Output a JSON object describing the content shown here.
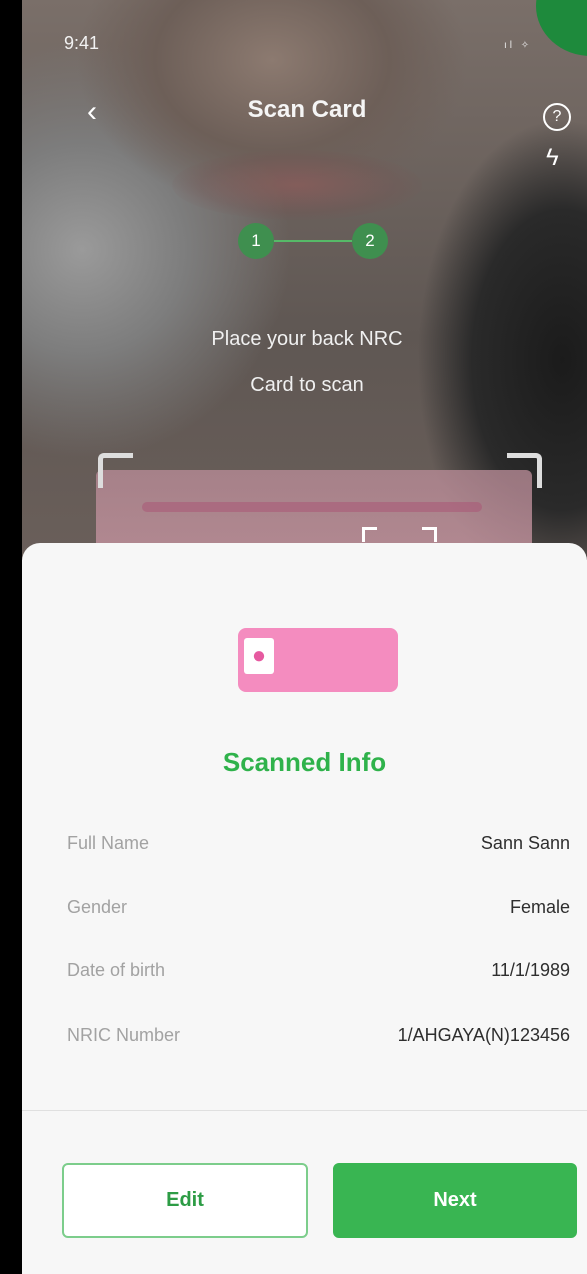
{
  "status_bar": {
    "time": "9:41",
    "status_icons": "ıl ✧"
  },
  "header": {
    "back_icon": "‹",
    "title": "Scan Card",
    "help_icon": "?",
    "flash_icon": "ϟ"
  },
  "steps": {
    "step1": "1",
    "step2": "2"
  },
  "instruction": {
    "line1": "Place your back NRC",
    "line2": "Card to scan"
  },
  "sheet": {
    "title": "Scanned Info",
    "fields": [
      {
        "label": "Full Name",
        "value": "Sann Sann"
      },
      {
        "label": "Gender",
        "value": "Female"
      },
      {
        "label": "Date of birth",
        "value": "11/1/1989"
      },
      {
        "label": "NRIC Number",
        "value": "1/AHGAYA(N)123456"
      }
    ],
    "edit_label": "Edit",
    "next_label": "Next"
  },
  "colors": {
    "accent": "#39b552",
    "step": "#3f8f4f",
    "card": "#f48cbf",
    "badge": "#1e8a3c"
  }
}
